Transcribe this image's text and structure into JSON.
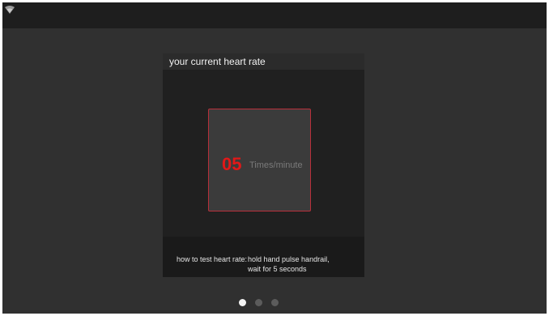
{
  "status_bar": {
    "icons": [
      "wifi-icon"
    ]
  },
  "card": {
    "title": "your current heart rate",
    "rate": {
      "value": "05",
      "unit": "Times/minute"
    },
    "instructions": {
      "label": "how to test heart rate:",
      "line1": "hold hand pulse handrail,",
      "line2": "wait for 5 seconds"
    }
  },
  "pager": {
    "pages": 3,
    "active_index": 0
  },
  "colors": {
    "accent": "#e11818",
    "frame_border": "#b8303b",
    "background": "#303030"
  }
}
